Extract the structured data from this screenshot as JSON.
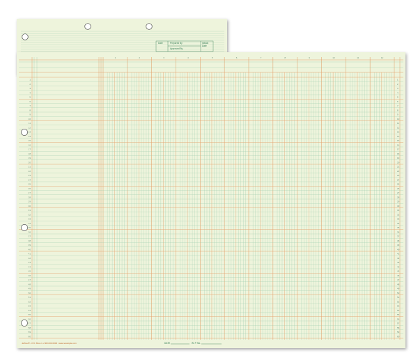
{
  "header": {
    "date_label": "Date",
    "prepared_by_label": "Prepared By",
    "approved_by_label": "Approved By",
    "initials_label": "Initials",
    "initials_label_2": "Date"
  },
  "footer": {
    "publisher_text": "Jeffmel® • P.O. Box xx • 800.000.0000 • www.example.com",
    "date_label": "DATE",
    "wp_label": "W. P. No."
  },
  "ledger": {
    "row_count": 60,
    "column_groups": 12,
    "paper_color": "#eef4dc",
    "green_rule_color": "#8fc7a6",
    "orange_rule_color": "#e3a06a"
  }
}
